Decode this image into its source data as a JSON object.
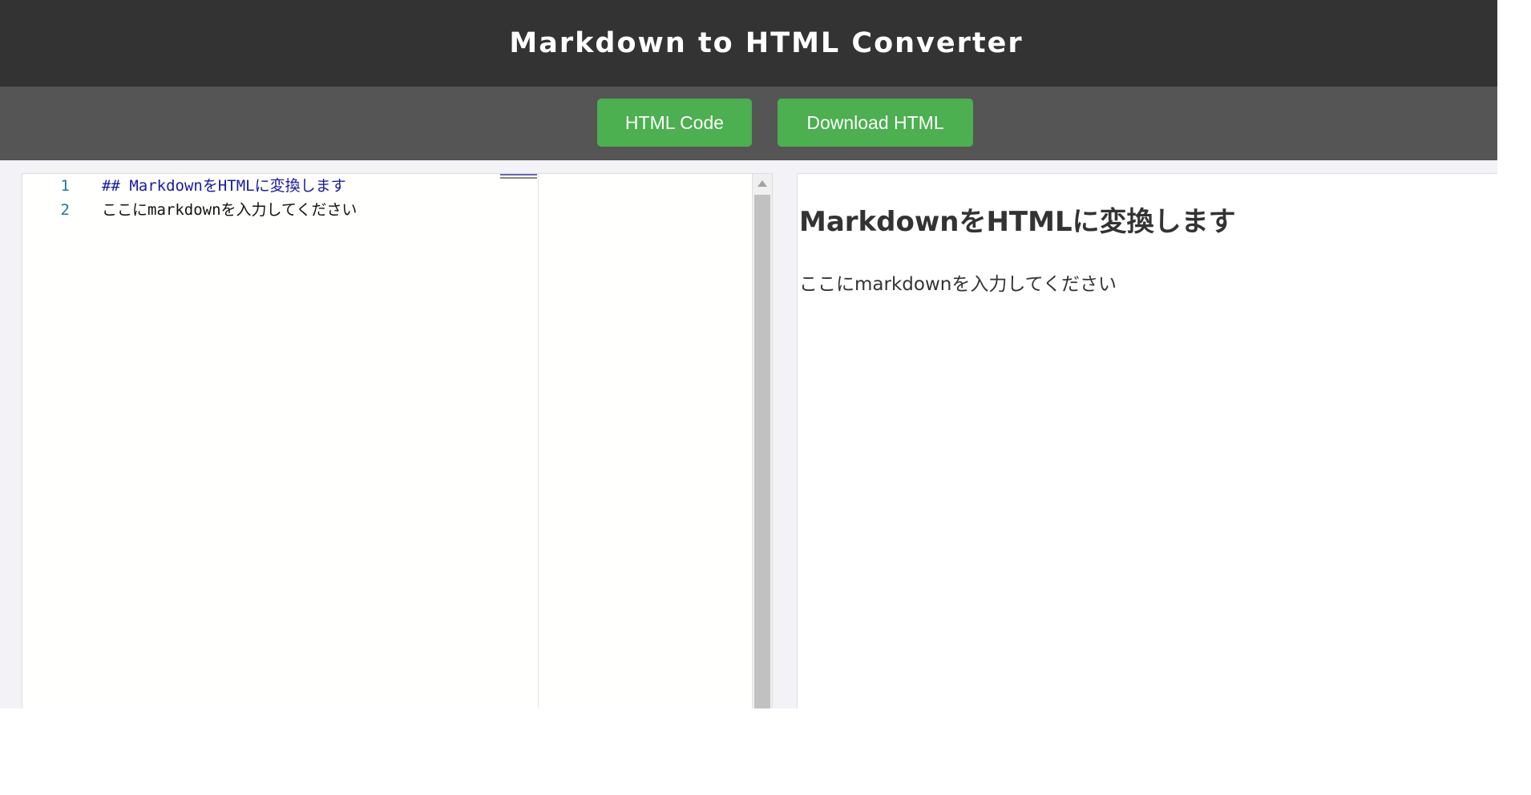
{
  "header": {
    "title": "Markdown to HTML Converter"
  },
  "toolbar": {
    "html_code_label": "HTML Code",
    "download_label": "Download HTML"
  },
  "editor": {
    "lines": [
      {
        "number": "1",
        "text": "## MarkdownをHTMLに変換します"
      },
      {
        "number": "2",
        "text": "ここにmarkdownを入力してください"
      }
    ]
  },
  "preview": {
    "heading": "MarkdownをHTMLに変換します",
    "paragraph": "ここにmarkdownを入力してください"
  },
  "colors": {
    "header_bg": "#333333",
    "toolbar_bg": "#555555",
    "button_bg": "#4caf50",
    "markdown_heading_token": "#1a1aa6",
    "line_number": "#237893"
  }
}
